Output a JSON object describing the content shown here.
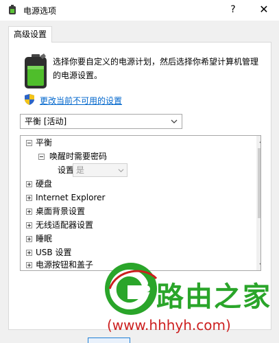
{
  "window": {
    "title": "电源选项",
    "help_glyph": "?",
    "close_glyph": "✕"
  },
  "tab": {
    "label": "高级设置"
  },
  "description": "选择你要自定义的电源计划，然后选择你希望计算机管理的电源设置。",
  "link": "更改当前不可用的设置",
  "plan_combo": {
    "value": "平衡 [活动]"
  },
  "tree": {
    "items": [
      {
        "label": "平衡",
        "expanded": true,
        "level": 0
      },
      {
        "label": "唤醒时需要密码",
        "expanded": true,
        "level": 1
      },
      {
        "label": "硬盘",
        "expanded": false,
        "level": 0
      },
      {
        "label": "Internet Explorer",
        "expanded": false,
        "level": 0
      },
      {
        "label": "桌面背景设置",
        "expanded": false,
        "level": 0
      },
      {
        "label": "无线适配器设置",
        "expanded": false,
        "level": 0
      },
      {
        "label": "睡眠",
        "expanded": false,
        "level": 0
      },
      {
        "label": "USB 设置",
        "expanded": false,
        "level": 0
      },
      {
        "label": "电源按钮和盖子",
        "expanded": false,
        "level": 0
      }
    ],
    "setting_label": "设置:",
    "setting_value": "是"
  },
  "watermark": {
    "main": "路由之家",
    "sub": "(www.hhhyh.com)",
    "color_main": "#2aa52a",
    "color_sub": "#cc1f1f"
  },
  "colors": {
    "link": "#0066cc",
    "focus_border": "#1e7fd6"
  },
  "icons": {
    "title": "battery-icon",
    "shield": "shield-icon",
    "battery_large": "battery-icon"
  }
}
